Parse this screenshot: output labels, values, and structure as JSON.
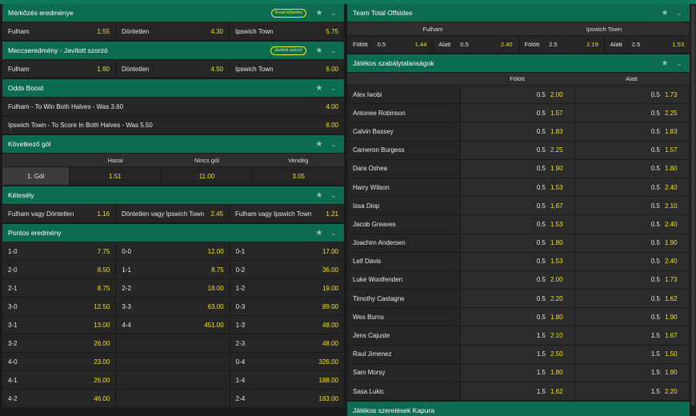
{
  "match_result": {
    "title": "Mérkőzés eredménye",
    "badge": "Korai kifizetés",
    "outcomes": [
      {
        "label": "Fulham",
        "odd": "1.55"
      },
      {
        "label": "Döntetlen",
        "odd": "4.30"
      },
      {
        "label": "Ipswich Town",
        "odd": "5.75"
      }
    ]
  },
  "enhanced_result": {
    "title": "Meccseredmény - Javított szorzó",
    "badge": "Javított szorzó",
    "outcomes": [
      {
        "label": "Fulham",
        "odd": "1.60"
      },
      {
        "label": "Döntetlen",
        "odd": "4.50"
      },
      {
        "label": "Ipswich Town",
        "odd": "6.00"
      }
    ]
  },
  "odds_boost": {
    "title": "Odds Boost",
    "items": [
      {
        "label": "Fulham - To Win Both Halves - Was 3.60",
        "odd": "4.00"
      },
      {
        "label": "Ipswich Town - To Score In Both Halves - Was 5.50",
        "odd": "6.00"
      }
    ]
  },
  "next_goal": {
    "title": "Következő gól",
    "headers": [
      "Hazai",
      "Nincs gól",
      "Vendég"
    ],
    "row_label": "1. Gól",
    "odds": [
      "1.51",
      "11.00",
      "3.05"
    ]
  },
  "double_chance": {
    "title": "Kétesély",
    "outcomes": [
      {
        "label": "Fulham vagy Döntetlen",
        "odd": "1.16"
      },
      {
        "label": "Döntetlen vagy Ipswich Town",
        "odd": "2.45"
      },
      {
        "label": "Fulham vagy Ipswich Town",
        "odd": "1.21"
      }
    ]
  },
  "correct_score": {
    "title": "Pontos eredmény",
    "rows": [
      [
        {
          "s": "1-0",
          "o": "7.75"
        },
        {
          "s": "0-0",
          "o": "12.00"
        },
        {
          "s": "0-1",
          "o": "17.00"
        }
      ],
      [
        {
          "s": "2-0",
          "o": "8.50"
        },
        {
          "s": "1-1",
          "o": "8.75"
        },
        {
          "s": "0-2",
          "o": "36.00"
        }
      ],
      [
        {
          "s": "2-1",
          "o": "8.75"
        },
        {
          "s": "2-2",
          "o": "18.00"
        },
        {
          "s": "1-2",
          "o": "19.00"
        }
      ],
      [
        {
          "s": "3-0",
          "o": "12.50"
        },
        {
          "s": "3-3",
          "o": "63.00"
        },
        {
          "s": "0-3",
          "o": "89.00"
        }
      ],
      [
        {
          "s": "3-1",
          "o": "13.00"
        },
        {
          "s": "4-4",
          "o": "451.00"
        },
        {
          "s": "1-3",
          "o": "48.00"
        }
      ],
      [
        {
          "s": "3-2",
          "o": "26.00"
        },
        {
          "s": "",
          "o": ""
        },
        {
          "s": "2-3",
          "o": "48.00"
        }
      ],
      [
        {
          "s": "4-0",
          "o": "23.00"
        },
        {
          "s": "",
          "o": ""
        },
        {
          "s": "0-4",
          "o": "326.00"
        }
      ],
      [
        {
          "s": "4-1",
          "o": "26.00"
        },
        {
          "s": "",
          "o": ""
        },
        {
          "s": "1-4",
          "o": "188.00"
        }
      ],
      [
        {
          "s": "4-2",
          "o": "46.00"
        },
        {
          "s": "",
          "o": ""
        },
        {
          "s": "2-4",
          "o": "163.00"
        }
      ]
    ]
  },
  "team_offsides": {
    "title": "Team Total Offsides",
    "teams": [
      "Fulham",
      "Ipswich Town"
    ],
    "cells": [
      {
        "label": "Fölött",
        "line": "0.5",
        "odd": "1.44"
      },
      {
        "label": "Alatt",
        "line": "0.5",
        "odd": "2.40"
      },
      {
        "label": "Fölött",
        "line": "2.5",
        "odd": "2.19"
      },
      {
        "label": "Alatt",
        "line": "2.5",
        "odd": "1.53"
      }
    ]
  },
  "player_fouls": {
    "title": "Játékos szabálytalanságok",
    "over_label": "Fölött",
    "under_label": "Alatt",
    "players": [
      {
        "name": "Alex Iwobi",
        "line": "0.5",
        "over": "2.00",
        "under": "1.73"
      },
      {
        "name": "Antonee Robinson",
        "line": "0.5",
        "over": "1.57",
        "under": "2.25"
      },
      {
        "name": "Calvin Bassey",
        "line": "0.5",
        "over": "1.83",
        "under": "1.83"
      },
      {
        "name": "Cameron Burgess",
        "line": "0.5",
        "over": "2.25",
        "under": "1.57"
      },
      {
        "name": "Dara Oshea",
        "line": "0.5",
        "over": "1.90",
        "under": "1.80"
      },
      {
        "name": "Harry Wilson",
        "line": "0.5",
        "over": "1.53",
        "under": "2.40"
      },
      {
        "name": "Issa Diop",
        "line": "0.5",
        "over": "1.67",
        "under": "2.10"
      },
      {
        "name": "Jacob Greaves",
        "line": "0.5",
        "over": "1.53",
        "under": "2.40"
      },
      {
        "name": "Joachim Andersen",
        "line": "0.5",
        "over": "1.80",
        "under": "1.90"
      },
      {
        "name": "Leif Davis",
        "line": "0.5",
        "over": "1.53",
        "under": "2.40"
      },
      {
        "name": "Luke Woolfenden",
        "line": "0.5",
        "over": "2.00",
        "under": "1.73"
      },
      {
        "name": "Timothy Castagne",
        "line": "0.5",
        "over": "2.20",
        "under": "1.62"
      },
      {
        "name": "Wes Burns",
        "line": "0.5",
        "over": "1.80",
        "under": "1.90"
      },
      {
        "name": "Jens Cajuste",
        "line": "1.5",
        "over": "2.10",
        "under": "1.67"
      },
      {
        "name": "Raul Jimenez",
        "line": "1.5",
        "over": "2.50",
        "under": "1.50"
      },
      {
        "name": "Sam Morsy",
        "line": "1.5",
        "over": "1.80",
        "under": "1.90"
      },
      {
        "name": "Sasa Lukic",
        "line": "1.5",
        "over": "1.62",
        "under": "2.20"
      }
    ]
  },
  "next_market_title": "Játékos szerelések Kapura",
  "icons": {
    "star": "star-icon",
    "chevron": "chevron-down-icon"
  },
  "colors": {
    "header_green": "#0d6b4f",
    "odd_yellow": "#f0e020",
    "badge_yellow": "#e8f234"
  }
}
